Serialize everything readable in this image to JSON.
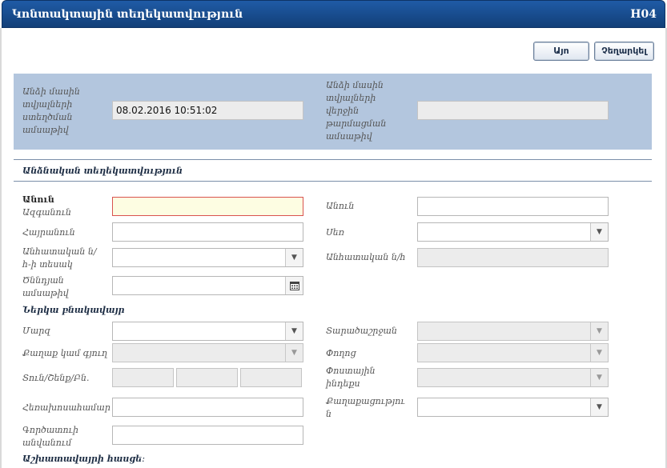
{
  "header": {
    "title": "Կոնտակտային տեղեկատվություն",
    "code": "H04"
  },
  "toolbar": {
    "save_label": "Այո",
    "cancel_label": "Չեղարկել"
  },
  "meta": {
    "created_label": "Անձի մասին տվյալների ստեղծման ամսաթիվ",
    "created_value": "08.02.2016 10:51:02",
    "updated_label": "Անձի մասին տվյալների վերջին թարմացման ամսաթիվ",
    "updated_value": ""
  },
  "personal": {
    "section_title": "Անձնական տեղեկատվություն",
    "surname_label_1": "Անուն",
    "surname_label_2": "Ազգանուն",
    "surname_value": "",
    "name_label": "Անուն",
    "name_value": "",
    "patronymic_label": "Հայրանուն",
    "patronymic_value": "",
    "gender_label": "Սեռ",
    "gender_value": "",
    "id_type_label": "Անհատական ն/հ-ի տեսակ",
    "id_type_value": "",
    "id_number_label": "Անհատական ն/հ",
    "id_number_value": "",
    "birth_date_label": "Ծննդյան ամսաթիվ",
    "birth_date_value": ""
  },
  "address": {
    "section_title": "Ներկա բնակավայր",
    "region_label": "Մարզ",
    "region_value": "",
    "district_label": "Տարածաշրջան",
    "city_label": "Քաղաք կամ գյուղ",
    "street_label": "Փողոց",
    "house_label": "Տուն/Շենք/Բն.",
    "postal_label": "Փոստային ինդեքս",
    "phone_label": "Հեռախոսահամար",
    "phone_value": "",
    "citizenship_label": "Քաղաքացություն",
    "citizenship_value": "",
    "workplace_label": "Գործատուի անվանում",
    "workplace_value": ""
  },
  "work": {
    "section_title": "Աշխատավայրի հասցե։"
  }
}
